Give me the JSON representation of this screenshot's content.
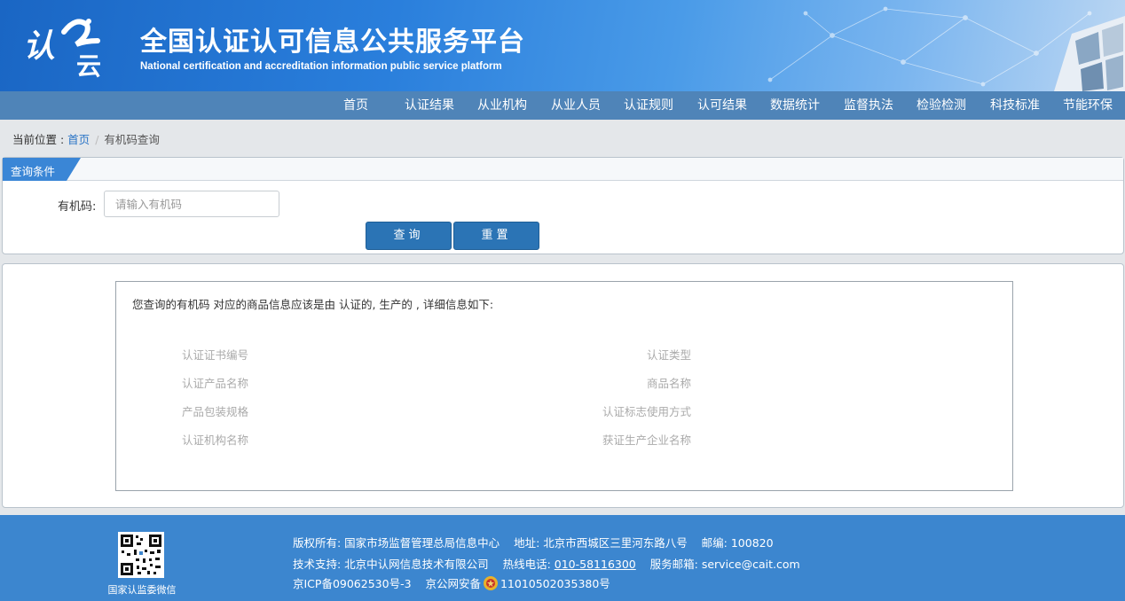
{
  "header": {
    "title": "全国认证认可信息公共服务平台",
    "subtitle": "National certification and accreditation information public service platform",
    "logo_text": "认云"
  },
  "nav": {
    "items": [
      "首页",
      "认证结果",
      "从业机构",
      "从业人员",
      "认证规则",
      "认可结果",
      "数据统计",
      "监督执法",
      "检验检测",
      "科技标准",
      "节能环保"
    ]
  },
  "breadcrumb": {
    "prefix": "当前位置 : ",
    "home": "首页",
    "separator": "/",
    "current": "有机码查询"
  },
  "query": {
    "tab_label": "查询条件",
    "field_label": "有机码:",
    "input_value": "",
    "input_placeholder": "请输入有机码",
    "search_label": "查询",
    "reset_label": "重置"
  },
  "result": {
    "description": "您查询的有机码 对应的商品信息应该是由 认证的,  生产的 , 详细信息如下:",
    "left_labels": [
      "认证证书编号",
      "认证产品名称",
      "产品包装规格",
      "认证机构名称"
    ],
    "right_labels": [
      "认证类型",
      "商品名称",
      "认证标志使用方式",
      "获证生产企业名称"
    ]
  },
  "footer": {
    "qr_caption": "国家认监委微信",
    "line1": "版权所有: 国家市场监督管理总局信息中心    地址: 北京市西城区三里河东路八号    邮编: 100820",
    "line2_prefix": "技术支持: 北京中认网信息技术有限公司    热线电话: ",
    "hotline": "010-58116300",
    "line2_suffix": "    服务邮箱: service@cait.com",
    "icp": "京ICP备09062530号-3",
    "police_prefix": "京公网安备",
    "police_number": "11010502035380号"
  },
  "colors": {
    "nav_bg": "#4f84b8",
    "button_bg": "#2b74b5",
    "footer_bg": "#3c86cf",
    "link": "#2a74c6"
  }
}
